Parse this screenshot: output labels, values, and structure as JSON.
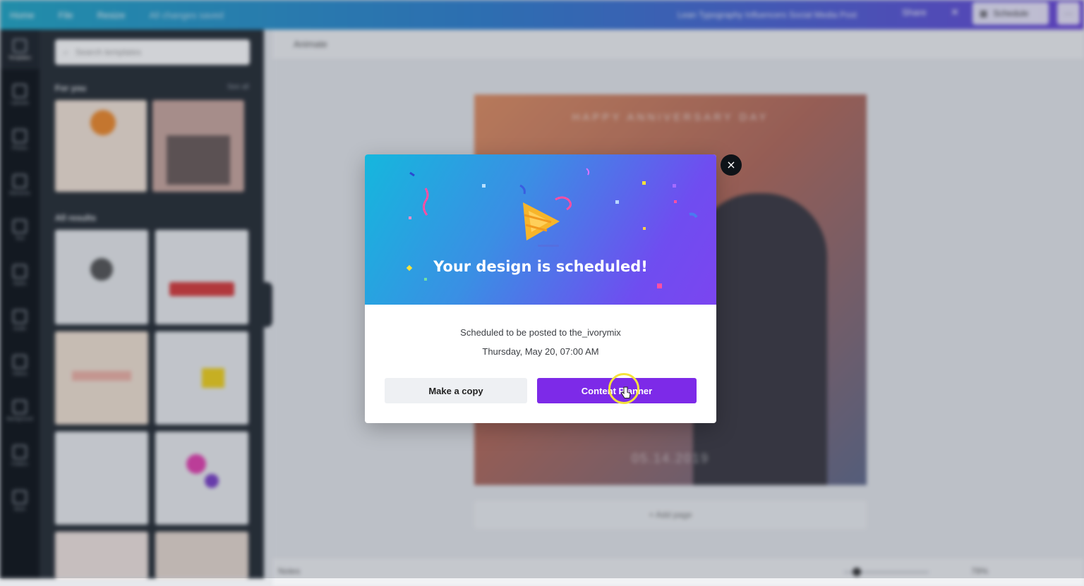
{
  "topbar": {
    "home": "Home",
    "file": "File",
    "resize": "Resize",
    "saved": "All changes saved",
    "design_title": "Lean Typography Influencers Social Media Post",
    "share": "Share",
    "schedule": "Schedule",
    "more": "···"
  },
  "rail": {
    "items": [
      "Templates",
      "Uploads",
      "Photos",
      "Elements",
      "Text",
      "Styles",
      "Audio",
      "Videos",
      "Background",
      "Folders",
      "More"
    ]
  },
  "panel": {
    "search_placeholder": "Search templates",
    "for_you": "For you",
    "see_all": "See all",
    "all_results": "All results"
  },
  "canvas": {
    "animate": "Animate",
    "headline": "HAPPY ANNIVERSARY DAY",
    "date": "05.14.2019",
    "add_page": "+ Add page",
    "notes": "Notes",
    "zoom": "79%"
  },
  "modal": {
    "title": "Your design is scheduled!",
    "line1": "Scheduled to be posted to the_ivorymix",
    "line2": "Thursday, May 20, 07:00 AM",
    "copy_button": "Make a copy",
    "planner_button": "Content Planner",
    "close": "×"
  },
  "colors": {
    "primary": "#7d2ae8",
    "hero_start": "#15b7dd",
    "hero_end": "#7b45f0",
    "highlight": "#f5e23a"
  }
}
